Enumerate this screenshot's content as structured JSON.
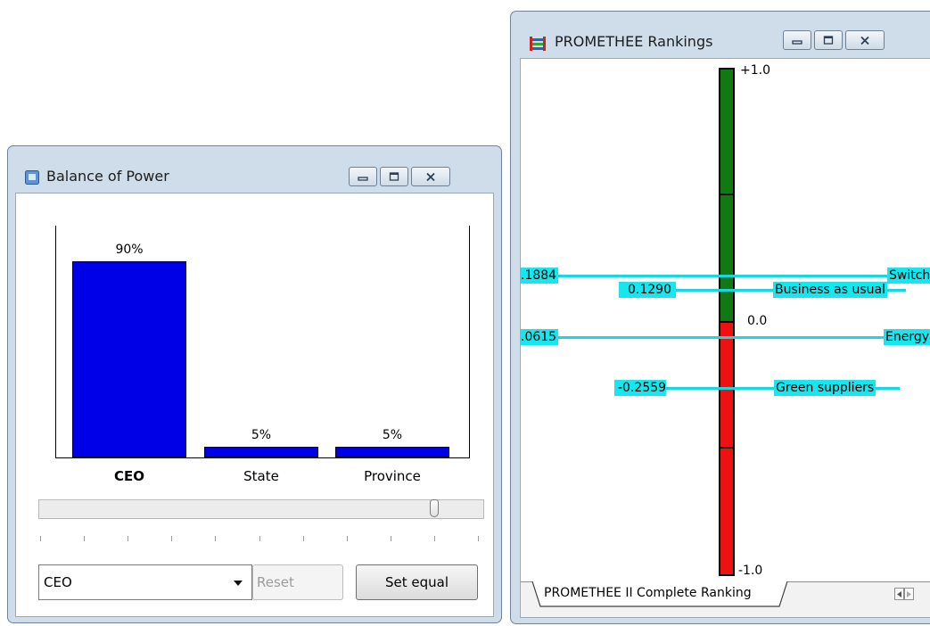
{
  "balance_window": {
    "title": "Balance of Power",
    "bars": [
      {
        "category": "CEO",
        "value": 90,
        "label": "90%",
        "bold": true
      },
      {
        "category": "State",
        "value": 5,
        "label": "5%",
        "bold": false
      },
      {
        "category": "Province",
        "value": 5,
        "label": "5%",
        "bold": false
      }
    ],
    "slider_value": 90,
    "dropdown_selected": "CEO",
    "reset_label": "Reset",
    "set_equal_label": "Set equal"
  },
  "promethee_window": {
    "title": "PROMETHEE Rankings",
    "scale_top": "+1.0",
    "scale_mid": "0.0",
    "scale_bottom": "-1.0",
    "rankings": [
      {
        "value_label": ".1884",
        "value": 0.1884,
        "name": "Switch"
      },
      {
        "value_label": "0.1290",
        "value": 0.129,
        "name": "Business as usual"
      },
      {
        "value_label": ".0615",
        "value": 0.0615,
        "name": "Energy"
      },
      {
        "value_label": "-0.2559",
        "value": -0.2559,
        "name": "Green suppliers"
      }
    ],
    "tab_label": "PROMETHEE II Complete Ranking"
  },
  "colors": {
    "bar_blue": "#0000e6",
    "positive_green": "#127812",
    "negative_red": "#ee1111",
    "line_cyan": "#17d7e3"
  }
}
